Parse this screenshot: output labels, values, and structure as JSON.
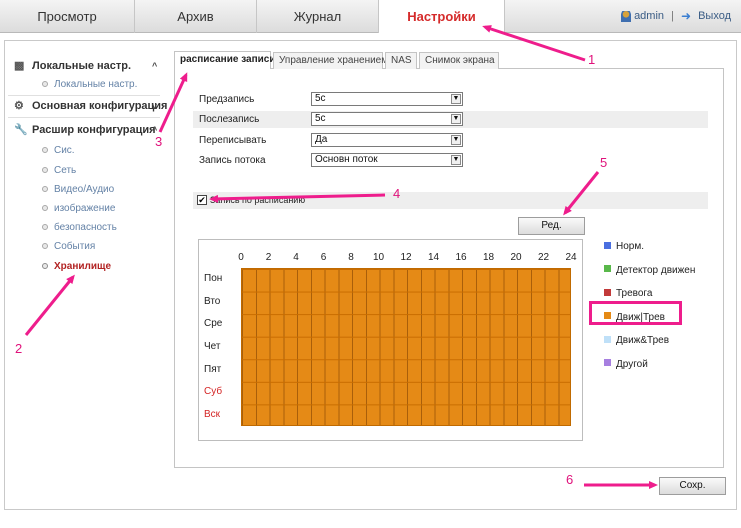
{
  "nav": {
    "tabs": [
      {
        "label": "Просмотр"
      },
      {
        "label": "Архив"
      },
      {
        "label": "Журнал"
      },
      {
        "label": "Настройки"
      }
    ],
    "user": "admin",
    "separator": "|",
    "logout": "Выход"
  },
  "sidebar": {
    "sections": [
      {
        "label": "Локальные настр.",
        "caret": "^"
      },
      {
        "label": "Основная конфигурация",
        "caret": "v"
      },
      {
        "label": "Расшир конфигурация",
        "caret": "^"
      }
    ],
    "items": [
      {
        "label": "Локальные настр."
      },
      {
        "label": "Сис."
      },
      {
        "label": "Сеть"
      },
      {
        "label": "Видео/Аудио"
      },
      {
        "label": "изображение"
      },
      {
        "label": "безопасность"
      },
      {
        "label": "События"
      },
      {
        "label": "Хранилище"
      }
    ]
  },
  "subtabs": [
    {
      "label": "расписание записи"
    },
    {
      "label": "Управление хранением"
    },
    {
      "label": "NAS"
    },
    {
      "label": "Снимок экрана"
    }
  ],
  "form": {
    "rows": [
      {
        "label": "Предзапись",
        "value": "5с"
      },
      {
        "label": "Послезапись",
        "value": "5с"
      },
      {
        "label": "Переписывать",
        "value": "Да"
      },
      {
        "label": "Запись потока",
        "value": "Основн поток"
      }
    ],
    "schedule_checkbox": {
      "label": "Запись по расписанию",
      "checked": true,
      "mark": "✔"
    }
  },
  "buttons": {
    "edit": "Ред.",
    "save": "Сохр."
  },
  "schedule": {
    "hours": [
      "0",
      "2",
      "4",
      "6",
      "8",
      "10",
      "12",
      "14",
      "16",
      "18",
      "20",
      "22",
      "24"
    ],
    "days": [
      {
        "label": "Пон",
        "weekend": false
      },
      {
        "label": "Вто",
        "weekend": false
      },
      {
        "label": "Сре",
        "weekend": false
      },
      {
        "label": "Чет",
        "weekend": false
      },
      {
        "label": "Пят",
        "weekend": false
      },
      {
        "label": "Суб",
        "weekend": true
      },
      {
        "label": "Вск",
        "weekend": true
      }
    ],
    "fill_color": "#e58a16"
  },
  "legend": [
    {
      "label": "Норм.",
      "color": "#4a6fe0"
    },
    {
      "label": "Детектор движен",
      "color": "#59b84a"
    },
    {
      "label": "Тревога",
      "color": "#c23a3a"
    },
    {
      "label": "Движ|Трев",
      "color": "#e58a16"
    },
    {
      "label": "Движ&Трев",
      "color": "#bfe0f8"
    },
    {
      "label": "Другой",
      "color": "#a77fe0"
    }
  ],
  "annotations": {
    "numbers": [
      "1",
      "2",
      "3",
      "4",
      "5",
      "6"
    ],
    "color": "#ee1d8c"
  }
}
